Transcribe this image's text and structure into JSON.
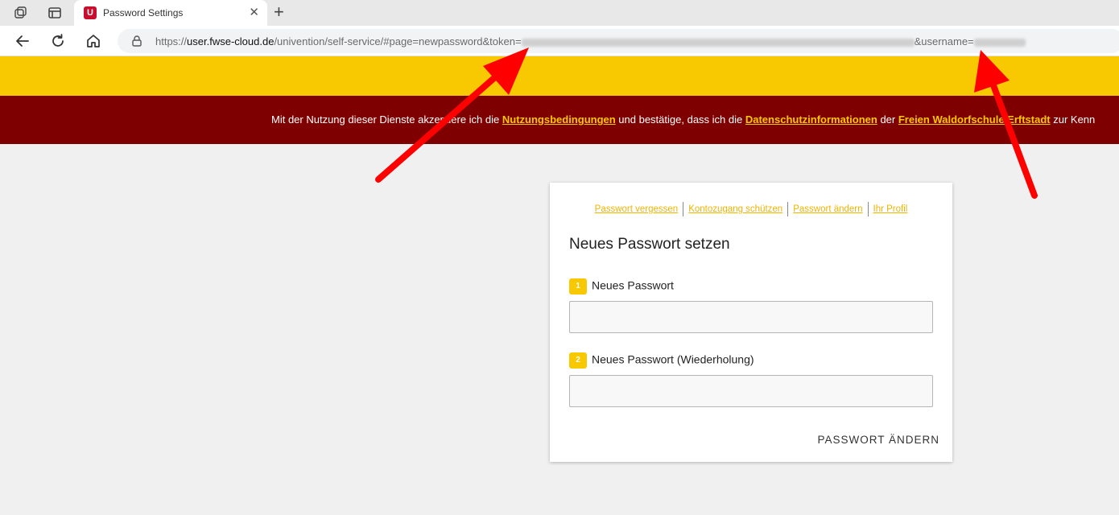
{
  "browser": {
    "tab_title": "Password Settings",
    "tab_favicon_letter": "U",
    "url": {
      "scheme": "https://",
      "host": "user.fwse-cloud.de",
      "path": "/univention/self-service/#page=newpassword&token=",
      "param2": "&username="
    }
  },
  "banner": {
    "text_before": "Mit der Nutzung dieser Dienste akzeptiere ich die ",
    "link_terms": "Nutzungsbedingungen",
    "text_middle": " und bestätige, dass ich die ",
    "link_privacy": "Datenschutzinformationen",
    "text_middle2": " der ",
    "link_school": "Freien Waldorfschule Erftstadt",
    "text_after": " zur Kenn"
  },
  "card": {
    "nav_links": [
      "Passwort vergessen",
      "Kontozugang schützen",
      "Passwort ändern",
      "Ihr Profil"
    ],
    "title": "Neues Passwort setzen",
    "fields": [
      {
        "number": "1",
        "label": "Neues Passwort",
        "value": ""
      },
      {
        "number": "2",
        "label": "Neues Passwort (Wiederholung)",
        "value": ""
      }
    ],
    "submit_label": "PASSWORT ÄNDERN"
  },
  "colors": {
    "accent_yellow": "#f8c800",
    "banner_red": "#7f0000",
    "arrow_red": "#ff0000"
  }
}
